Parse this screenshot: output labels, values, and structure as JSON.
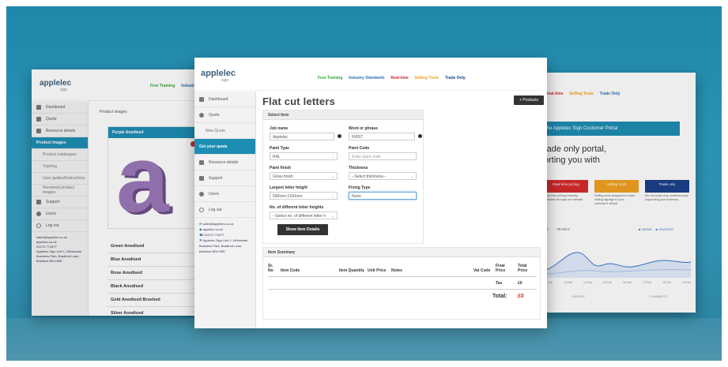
{
  "left": {
    "logo": "applelec",
    "logo_sub": "sign",
    "topnav": [
      "Free Training",
      "Industry"
    ],
    "sidebar": [
      "Dashboard",
      "Quote",
      "Resource details",
      "Product Images",
      "Product catalogues",
      "Training",
      "User guides/Instructions",
      "Rendered product images",
      "Support",
      "Users",
      "Log out"
    ],
    "content_title": "Product images",
    "card_title": "Purple Anodised",
    "letter": "a",
    "finishes": [
      "Green Anodised",
      "Blue Anodised",
      "Rose Anodised",
      "Black Anodised",
      "Gold Anodised Brushed",
      "Silver Anodised"
    ],
    "contact": [
      "sales@applelec.co.uk",
      "applelec.co.uk",
      "01274 774477",
      "Applelec Sign Unit 1, Wholesale Business Park, Bradford Lane, Bradford BD3 8SE"
    ]
  },
  "center": {
    "logo": "applelec",
    "logo_sub": "sign",
    "topnav": [
      {
        "label": "Free Training",
        "color": "#3aa33a"
      },
      {
        "label": "Industry Standards",
        "color": "#2a6fb5"
      },
      {
        "label": "Real-time",
        "color": "#d52b2b"
      },
      {
        "label": "Selling Tools",
        "color": "#f0a020"
      },
      {
        "label": "Trade Only",
        "color": "#1b3f8a"
      }
    ],
    "sidebar": {
      "dashboard": "Dashboard",
      "quote": "Quote",
      "new_quote": "New Quote",
      "get_quote": "Get your quote",
      "resource": "Resource details",
      "support": "Support",
      "users": "Users",
      "logout": "Log out"
    },
    "contact": [
      "sales@applelec.co.uk",
      "applelec.co.uk",
      "01274 774477",
      "Applelec Sign Unit 1, Wholesale Business Park, Bradford Lane, Bradford BD3 8SE"
    ],
    "page_title": "Flat cut letters",
    "products_button": "+ Products",
    "form": {
      "header": "Select Item",
      "job_name_label": "Job name",
      "job_name_value": "Applelec",
      "word_label": "Word or phrase",
      "word_value": "FIRST",
      "paint_type_label": "Paint Type",
      "paint_type_value": "RAL",
      "paint_code_label": "Paint Code",
      "paint_code_placeholder": "Enter paint code",
      "paint_finish_label": "Paint finish",
      "paint_finish_value": "Gloss finish",
      "thickness_label": "Thickness",
      "thickness_value": "--Select thickness--",
      "height_label": "Largest letter height",
      "height_value": "500mm-1150mm",
      "fixing_label": "Fixing Type",
      "fixing_value": "None",
      "weights_label": "No. of different letter heights",
      "weights_value": "--Select no. of different letter h",
      "show_button": "Show Item Details"
    },
    "summary": {
      "header": "Item Summary",
      "cols": [
        "Sr. No",
        "Item Code",
        "Item Quantity",
        "Unit Price",
        "Notes",
        "Vat Code",
        "Final Price",
        "Total Price"
      ],
      "tax_label": "Tax",
      "tax_value": "£0",
      "total_label": "Total:",
      "total_value": "£0"
    }
  },
  "right": {
    "topnav": [
      "Real-time",
      "Selling Tools",
      "Trade Only"
    ],
    "banner": "the Applelec Sign Customer Portal",
    "hero_line1": "rade only portal,",
    "hero_line2": "orting you with",
    "tiles": [
      {
        "title": "Real time pricing",
        "text": "Real time pricing instantly available through our website",
        "color": "#d52b2b"
      },
      {
        "title": "Selling tools",
        "text": "Selling tools designed to make selling signage to your customers simple",
        "color": "#f0a020"
      },
      {
        "title": "Trade only",
        "text": "We are trade only, professionally supporting your business",
        "color": "#1b3f8a"
      }
    ],
    "chart_tabs": [
      "ILY",
      "YEARLY"
    ],
    "legend": [
      "VIEWS",
      "VISITORS"
    ],
    "x_ticks": [
      "12 Feb",
      "13 Feb",
      "14 Feb",
      "15 Feb",
      "16 Feb",
      "17 Feb",
      "18 Feb",
      "19 Feb"
    ],
    "stats": [
      "SHARES",
      "COMMENTS"
    ]
  }
}
